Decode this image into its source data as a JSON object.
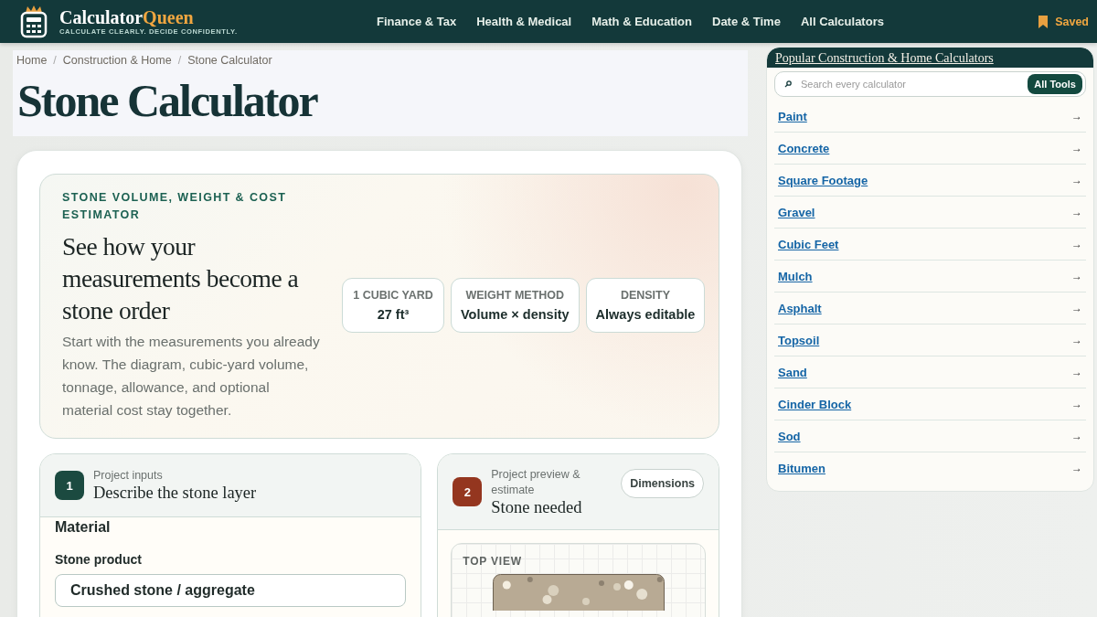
{
  "header": {
    "brand": {
      "name": "Calculator",
      "accent": "Queen",
      "tagline": "CALCULATE CLEARLY. DECIDE CONFIDENTLY."
    },
    "nav": [
      "Finance & Tax",
      "Health & Medical",
      "Math & Education",
      "Date & Time",
      "All Calculators"
    ],
    "saved": "Saved"
  },
  "breadcrumb": [
    "Home",
    "Construction & Home",
    "Stone Calculator"
  ],
  "breadcrumb_separator": "/",
  "page_title": "Stone Calculator",
  "hero": {
    "eyebrow": "STONE VOLUME, WEIGHT & COST ESTIMATOR",
    "heading": "See how your measurements become a stone order",
    "body": "Start with the measurements you already know. The diagram, cubic-yard volume, tonnage, allowance, and optional material cost stay together.",
    "facts": [
      {
        "label": "1 CUBIC YARD",
        "value": "27 ft³"
      },
      {
        "label": "WEIGHT METHOD",
        "value": "Volume × density"
      },
      {
        "label": "DENSITY",
        "value": "Always editable"
      }
    ]
  },
  "steps": [
    {
      "number": "1",
      "color": "#1b4a40",
      "kicker": "Project inputs",
      "title": "Describe the stone layer"
    },
    {
      "number": "2",
      "color": "#94361f",
      "kicker": "Project preview & estimate",
      "title": "Stone needed",
      "button": "Dimensions"
    }
  ],
  "inputs": {
    "section": "Material",
    "field_label": "Stone product",
    "value": "Crushed stone / aggregate"
  },
  "preview": {
    "label": "TOP VIEW"
  },
  "sidebar": {
    "title": "Popular Construction & Home Calculators",
    "search_placeholder": "Search every calculator",
    "search_button": "All Tools",
    "links": [
      {
        "label": "Paint",
        "arrow": "→"
      },
      {
        "label": "Concrete",
        "arrow": "→"
      },
      {
        "label": "Square Footage",
        "arrow": "→"
      },
      {
        "label": "Gravel",
        "arrow": "→"
      },
      {
        "label": "Cubic Feet",
        "arrow": "→"
      },
      {
        "label": "Mulch",
        "arrow": "→"
      },
      {
        "label": "Asphalt",
        "arrow": "→"
      },
      {
        "label": "Topsoil",
        "arrow": "→"
      },
      {
        "label": "Sand",
        "arrow": "→"
      },
      {
        "label": "Cinder Block",
        "arrow": "→"
      },
      {
        "label": "Sod",
        "arrow": "→"
      },
      {
        "label": "Bitumen",
        "arrow": "→"
      }
    ]
  }
}
